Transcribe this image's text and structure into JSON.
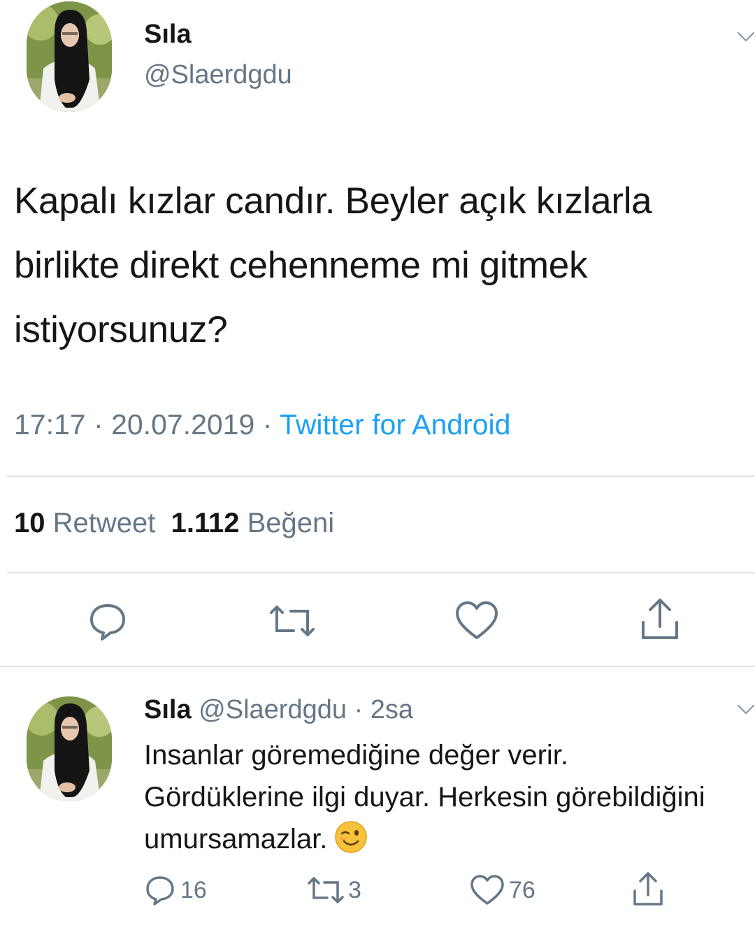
{
  "main_tweet": {
    "name": "Sıla",
    "handle": "@Slaerdgdu",
    "text": "Kapalı kızlar candır. Beyler açık kızlarla birlikte direkt cehenneme mi gitmek istiyorsunuz?",
    "time": "17:17",
    "date": "20.07.2019",
    "source": "Twitter for Android",
    "sep": "·",
    "retweet_count": "10",
    "retweet_label": "Retweet",
    "like_count": "1.112",
    "like_label": "Beğeni"
  },
  "reply_tweet": {
    "name": "Sıla",
    "handle": "@Slaerdgdu",
    "sep": "·",
    "age": "2sa",
    "text": "Insanlar göremediğine değer verir. Gördüklerine ilgi duyar. Herkesin görebildiğini umursamazlar.",
    "emoji": "winking-face",
    "reply_count": "16",
    "retweet_count": "3",
    "like_count": "76"
  },
  "icons": {
    "reply": "speech-bubble-icon",
    "retweet": "retweet-arrows-icon",
    "like": "heart-icon",
    "share": "share-upload-icon",
    "menu": "chevron-down-icon"
  },
  "colors": {
    "text": "#14171a",
    "secondary": "#657786",
    "link": "#1da1f2",
    "divider": "#dfe3e7"
  }
}
